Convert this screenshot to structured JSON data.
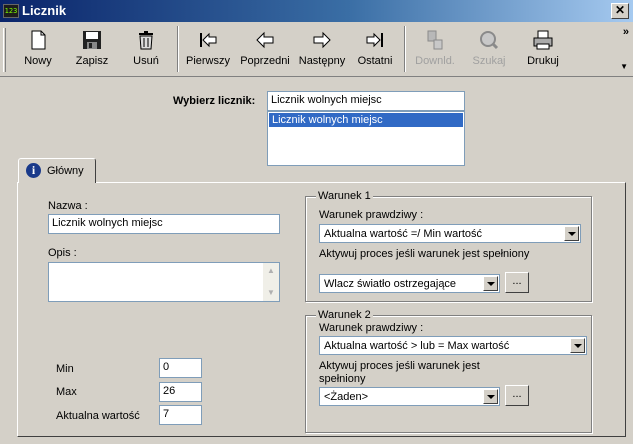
{
  "window": {
    "title": "Licznik",
    "app_icon_text": "123"
  },
  "toolbar": {
    "buttons": [
      {
        "label": "Nowy",
        "icon": "new-document-icon",
        "enabled": true
      },
      {
        "label": "Zapisz",
        "icon": "floppy-disk-icon",
        "enabled": true
      },
      {
        "label": "Usuń",
        "icon": "trash-bin-icon",
        "enabled": true
      },
      {
        "label": "Pierwszy",
        "icon": "first-record-icon",
        "enabled": true
      },
      {
        "label": "Poprzedni",
        "icon": "previous-arrow-icon",
        "enabled": true
      },
      {
        "label": "Następny",
        "icon": "next-arrow-icon",
        "enabled": true
      },
      {
        "label": "Ostatni",
        "icon": "last-record-icon",
        "enabled": true
      },
      {
        "label": "Downld.",
        "icon": "download-icon",
        "enabled": false
      },
      {
        "label": "Szukaj",
        "icon": "search-icon",
        "enabled": false
      },
      {
        "label": "Drukuj",
        "icon": "printer-icon",
        "enabled": true
      }
    ],
    "more_glyph": "»",
    "more_arrow_glyph": "▼"
  },
  "selector": {
    "label": "Wybierz licznik:",
    "value": "Licznik wolnych miejsc",
    "options": [
      "Licznik wolnych miejsc"
    ],
    "selected_index": 0
  },
  "tabs": [
    {
      "label": "Główny",
      "icon": "info-icon",
      "icon_glyph": "i",
      "active": true
    }
  ],
  "form": {
    "name_label": "Nazwa :",
    "name_value": "Licznik wolnych miejsc",
    "desc_label": "Opis :",
    "desc_value": "",
    "min_label": "Min",
    "min_value": "0",
    "max_label": "Max",
    "max_value": "26",
    "current_label": "Aktualna wartość",
    "current_value": "7"
  },
  "condition1": {
    "title": "Warunek 1",
    "true_label": "Warunek prawdziwy :",
    "true_value": "Aktualna wartość =/ Min wartość",
    "process_label": "Aktywuj proces jeśli warunek jest spełniony",
    "process_value": "Wlacz światło ostrzegające",
    "browse_label": "..."
  },
  "condition2": {
    "title": "Warunek 2",
    "true_label": "Warunek prawdziwy :",
    "true_value": "Aktualna wartość > lub = Max wartość",
    "process_label_line1": "Aktywuj proces jeśli warunek jest",
    "process_label_line2": "spełniony",
    "process_value": "<Żaden>",
    "browse_label": "..."
  },
  "colors": {
    "titlebar_start": "#0a246a",
    "titlebar_end": "#a6caf0",
    "face": "#d4d0c8",
    "selection": "#316ac5",
    "disabled_text": "#a0a0a0"
  }
}
